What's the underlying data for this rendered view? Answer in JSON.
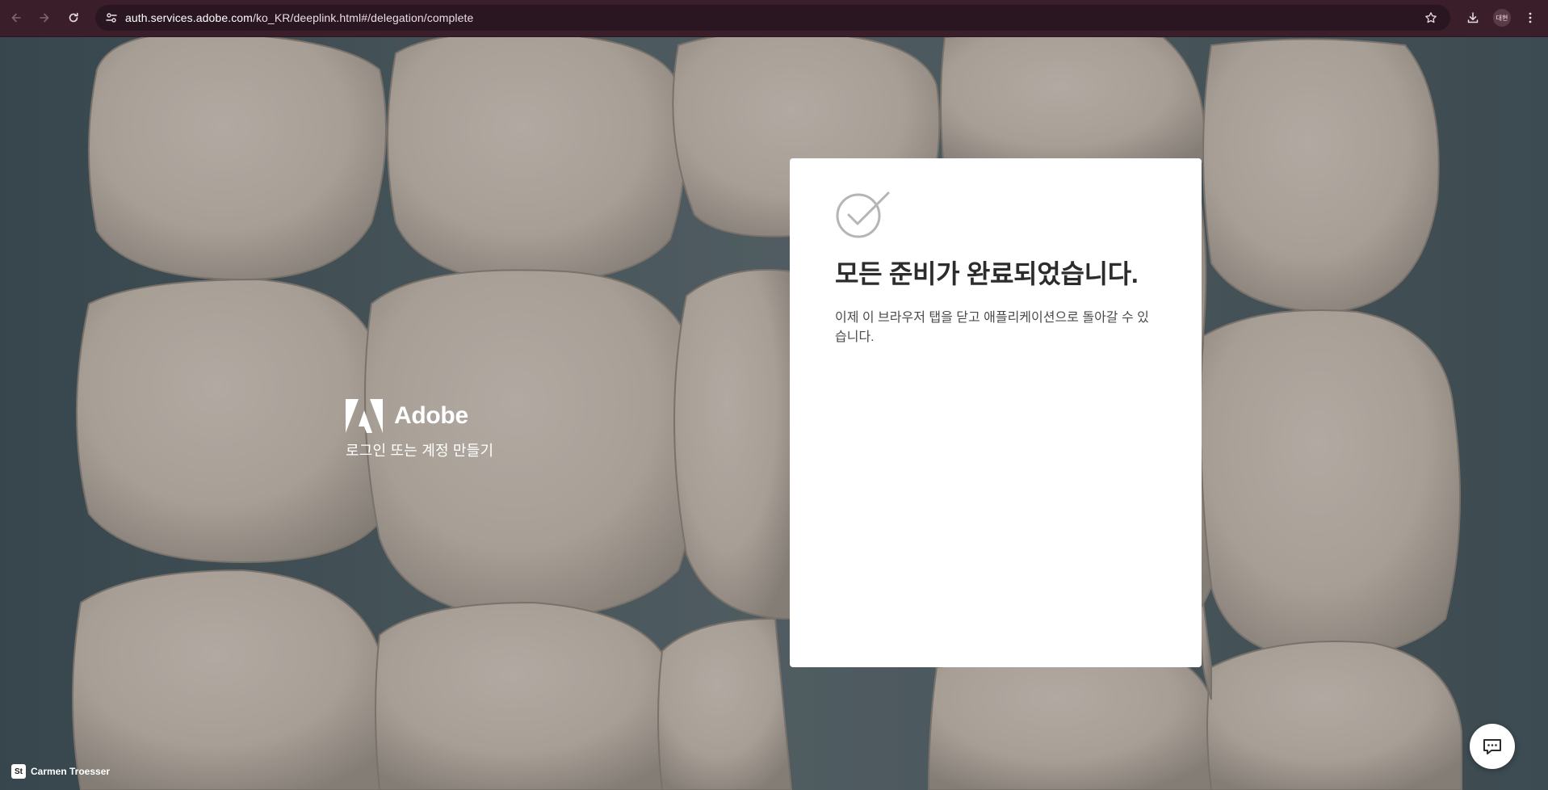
{
  "browser": {
    "url_host": "auth.services.adobe.com",
    "url_path": "/ko_KR/deeplink.html#/delegation/complete",
    "profile_label": "대현",
    "icons": [
      "back-icon",
      "forward-icon",
      "reload-icon",
      "site-info-icon",
      "bookmark-star-icon",
      "download-icon",
      "menu-icon"
    ]
  },
  "brand": {
    "name": "Adobe",
    "subtitle": "로그인 또는 계정 만들기"
  },
  "card": {
    "title": "모든 준비가 완료되었습니다.",
    "description": "이제 이 브라우저 탭을 닫고 애플리케이션으로 돌아갈 수 있습니다."
  },
  "credit": {
    "badge": "St",
    "author": "Carmen Troesser"
  },
  "colors": {
    "toolbar": "#3a1f2b",
    "card": "#ffffff",
    "dough": "#d9cfc4",
    "tray": "#5e7178"
  }
}
